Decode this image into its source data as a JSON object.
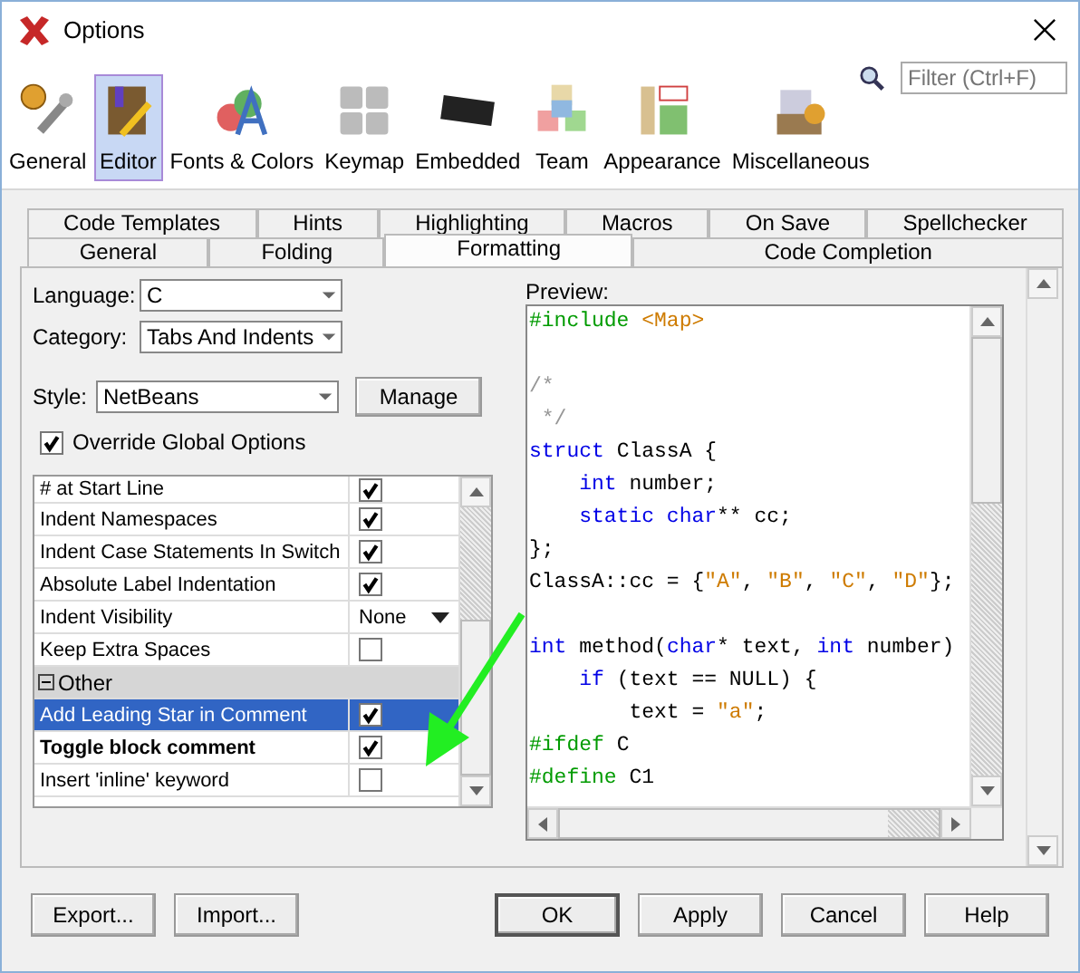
{
  "window": {
    "title": "Options"
  },
  "categories": [
    {
      "label": "General",
      "selected": false
    },
    {
      "label": "Editor",
      "selected": true
    },
    {
      "label": "Fonts & Colors",
      "selected": false
    },
    {
      "label": "Keymap",
      "selected": false
    },
    {
      "label": "Embedded",
      "selected": false
    },
    {
      "label": "Team",
      "selected": false
    },
    {
      "label": "Appearance",
      "selected": false
    },
    {
      "label": "Miscellaneous",
      "selected": false
    }
  ],
  "filter": {
    "placeholder": "Filter (Ctrl+F)"
  },
  "tabs_back": [
    {
      "label": "Code Templates",
      "selected": false
    },
    {
      "label": "Hints",
      "selected": false
    },
    {
      "label": "Highlighting",
      "selected": false
    },
    {
      "label": "Macros",
      "selected": false
    },
    {
      "label": "On Save",
      "selected": false
    },
    {
      "label": "Spellchecker",
      "selected": false
    }
  ],
  "tabs_front": [
    {
      "label": "General",
      "selected": false
    },
    {
      "label": "Folding",
      "selected": false
    },
    {
      "label": "Formatting",
      "selected": true
    },
    {
      "label": "Code Completion",
      "selected": false
    }
  ],
  "language": {
    "label": "Language:",
    "value": "C"
  },
  "category": {
    "label": "Category:",
    "value": "Tabs And Indents"
  },
  "style": {
    "label": "Style:",
    "value": "NetBeans",
    "button": "Manage"
  },
  "override": {
    "label": "Override Global Options",
    "checked": true
  },
  "properties": [
    {
      "kind": "check",
      "name": "# at Start Line",
      "checked": true,
      "selected": false,
      "bold": false
    },
    {
      "kind": "check",
      "name": "Indent Namespaces",
      "checked": true,
      "selected": false,
      "bold": false
    },
    {
      "kind": "check",
      "name": "Indent Case Statements In Switch",
      "checked": true,
      "selected": false,
      "bold": false
    },
    {
      "kind": "check",
      "name": "Absolute Label Indentation",
      "checked": true,
      "selected": false,
      "bold": false
    },
    {
      "kind": "choice",
      "name": "Indent Visibility",
      "value": "None",
      "selected": false,
      "bold": false
    },
    {
      "kind": "check",
      "name": "Keep Extra Spaces",
      "checked": false,
      "selected": false,
      "bold": false
    },
    {
      "kind": "group",
      "name": "Other",
      "expanded": true
    },
    {
      "kind": "check",
      "name": "Add Leading Star in Comment",
      "checked": true,
      "selected": true,
      "bold": false
    },
    {
      "kind": "check",
      "name": "Toggle block comment",
      "checked": true,
      "selected": false,
      "bold": true
    },
    {
      "kind": "check",
      "name": "Insert 'inline' keyword",
      "checked": false,
      "selected": false,
      "bold": false
    }
  ],
  "preview": {
    "label": "Preview:",
    "lines": [
      {
        "kind": "code",
        "parts": [
          {
            "kind": "preproc",
            "text": "#include "
          },
          {
            "kind": "string",
            "text": "<Map>"
          }
        ]
      },
      {
        "kind": "blank"
      },
      {
        "kind": "code",
        "parts": [
          {
            "kind": "comment",
            "text": "/*"
          }
        ]
      },
      {
        "kind": "code",
        "parts": [
          {
            "kind": "comment",
            "text": " */"
          }
        ]
      },
      {
        "kind": "code",
        "parts": [
          {
            "kind": "keyword",
            "text": "struct"
          },
          {
            "kind": "plain",
            "text": " ClassA {"
          }
        ]
      },
      {
        "kind": "code",
        "parts": [
          {
            "kind": "keyword",
            "text": "    int"
          },
          {
            "kind": "plain",
            "text": " number;"
          }
        ]
      },
      {
        "kind": "code",
        "parts": [
          {
            "kind": "keyword",
            "text": "    static char"
          },
          {
            "kind": "plain",
            "text": "** cc;"
          }
        ]
      },
      {
        "kind": "code",
        "parts": [
          {
            "kind": "plain",
            "text": "};"
          }
        ]
      },
      {
        "kind": "code",
        "parts": [
          {
            "kind": "plain",
            "text": "ClassA::cc = {"
          },
          {
            "kind": "string",
            "text": "\"A\""
          },
          {
            "kind": "plain",
            "text": ", "
          },
          {
            "kind": "string",
            "text": "\"B\""
          },
          {
            "kind": "plain",
            "text": ", "
          },
          {
            "kind": "string",
            "text": "\"C\""
          },
          {
            "kind": "plain",
            "text": ", "
          },
          {
            "kind": "string",
            "text": "\"D\""
          },
          {
            "kind": "plain",
            "text": "};"
          }
        ]
      },
      {
        "kind": "blank"
      },
      {
        "kind": "code",
        "parts": [
          {
            "kind": "keyword",
            "text": "int"
          },
          {
            "kind": "plain",
            "text": " method("
          },
          {
            "kind": "keyword",
            "text": "char"
          },
          {
            "kind": "plain",
            "text": "* text, "
          },
          {
            "kind": "keyword",
            "text": "int"
          },
          {
            "kind": "plain",
            "text": " number)"
          }
        ]
      },
      {
        "kind": "code",
        "parts": [
          {
            "kind": "keyword",
            "text": "    if"
          },
          {
            "kind": "plain",
            "text": " (text == NULL) {"
          }
        ]
      },
      {
        "kind": "code",
        "parts": [
          {
            "kind": "plain",
            "text": "        text = "
          },
          {
            "kind": "string",
            "text": "\"a\""
          },
          {
            "kind": "plain",
            "text": ";"
          }
        ]
      },
      {
        "kind": "code",
        "parts": [
          {
            "kind": "preproc",
            "text": "#ifdef"
          },
          {
            "kind": "plain",
            "text": " C"
          }
        ]
      },
      {
        "kind": "code",
        "parts": [
          {
            "kind": "preproc",
            "text": "#define"
          },
          {
            "kind": "plain",
            "text": " C1"
          }
        ]
      }
    ]
  },
  "left_buttons": [
    "Export...",
    "Import..."
  ],
  "right_buttons": [
    {
      "label": "OK",
      "default": true
    },
    {
      "label": "Apply",
      "default": false
    },
    {
      "label": "Cancel",
      "default": false
    },
    {
      "label": "Help",
      "default": false
    }
  ]
}
